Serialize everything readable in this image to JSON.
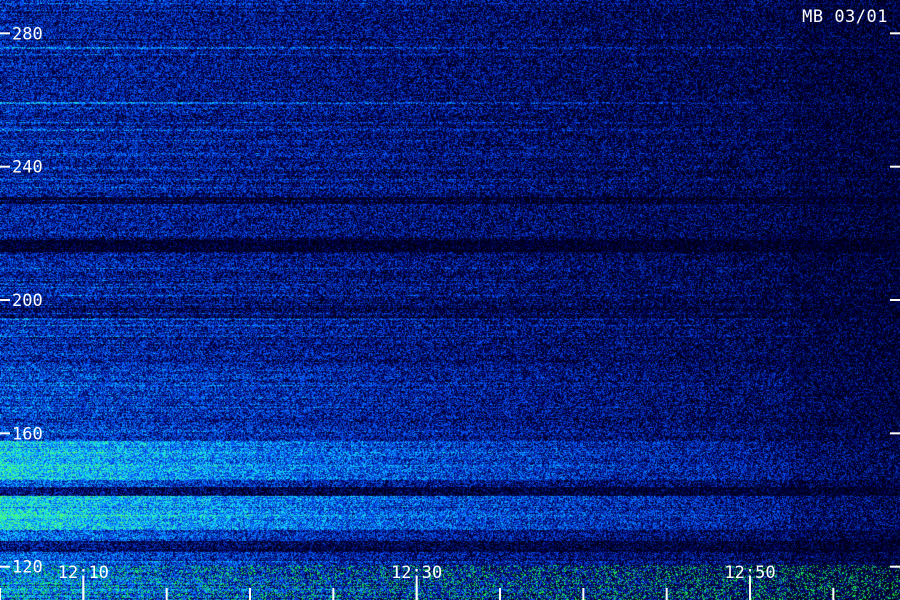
{
  "station_label": "MB 03/01",
  "chart_data": {
    "type": "heatmap",
    "title": "",
    "xlabel": "",
    "ylabel": "",
    "x_range": [
      "12:05",
      "12:59"
    ],
    "ylim": [
      110,
      290
    ],
    "y_ticks": [
      120,
      160,
      200,
      240,
      280
    ],
    "y_tick_labels": [
      "120",
      "160",
      "200",
      "240",
      "280"
    ],
    "x_tick_labels": [
      {
        "time": "12:10",
        "label": "12:10"
      },
      {
        "time": "12:30",
        "label": "12:30"
      },
      {
        "time": "12:50",
        "label": "12:50"
      }
    ],
    "x_minor_ticks": [
      "12:05",
      "12:10",
      "12:15",
      "12:20",
      "12:25",
      "12:30",
      "12:35",
      "12:40",
      "12:45",
      "12:50",
      "12:55"
    ],
    "colors": {
      "background": "#000000",
      "low": "#0a0a5a",
      "mid": "#1e3cff",
      "high": "#20d0ff",
      "peak": "#40ff80",
      "axis": "#ffffff"
    }
  }
}
